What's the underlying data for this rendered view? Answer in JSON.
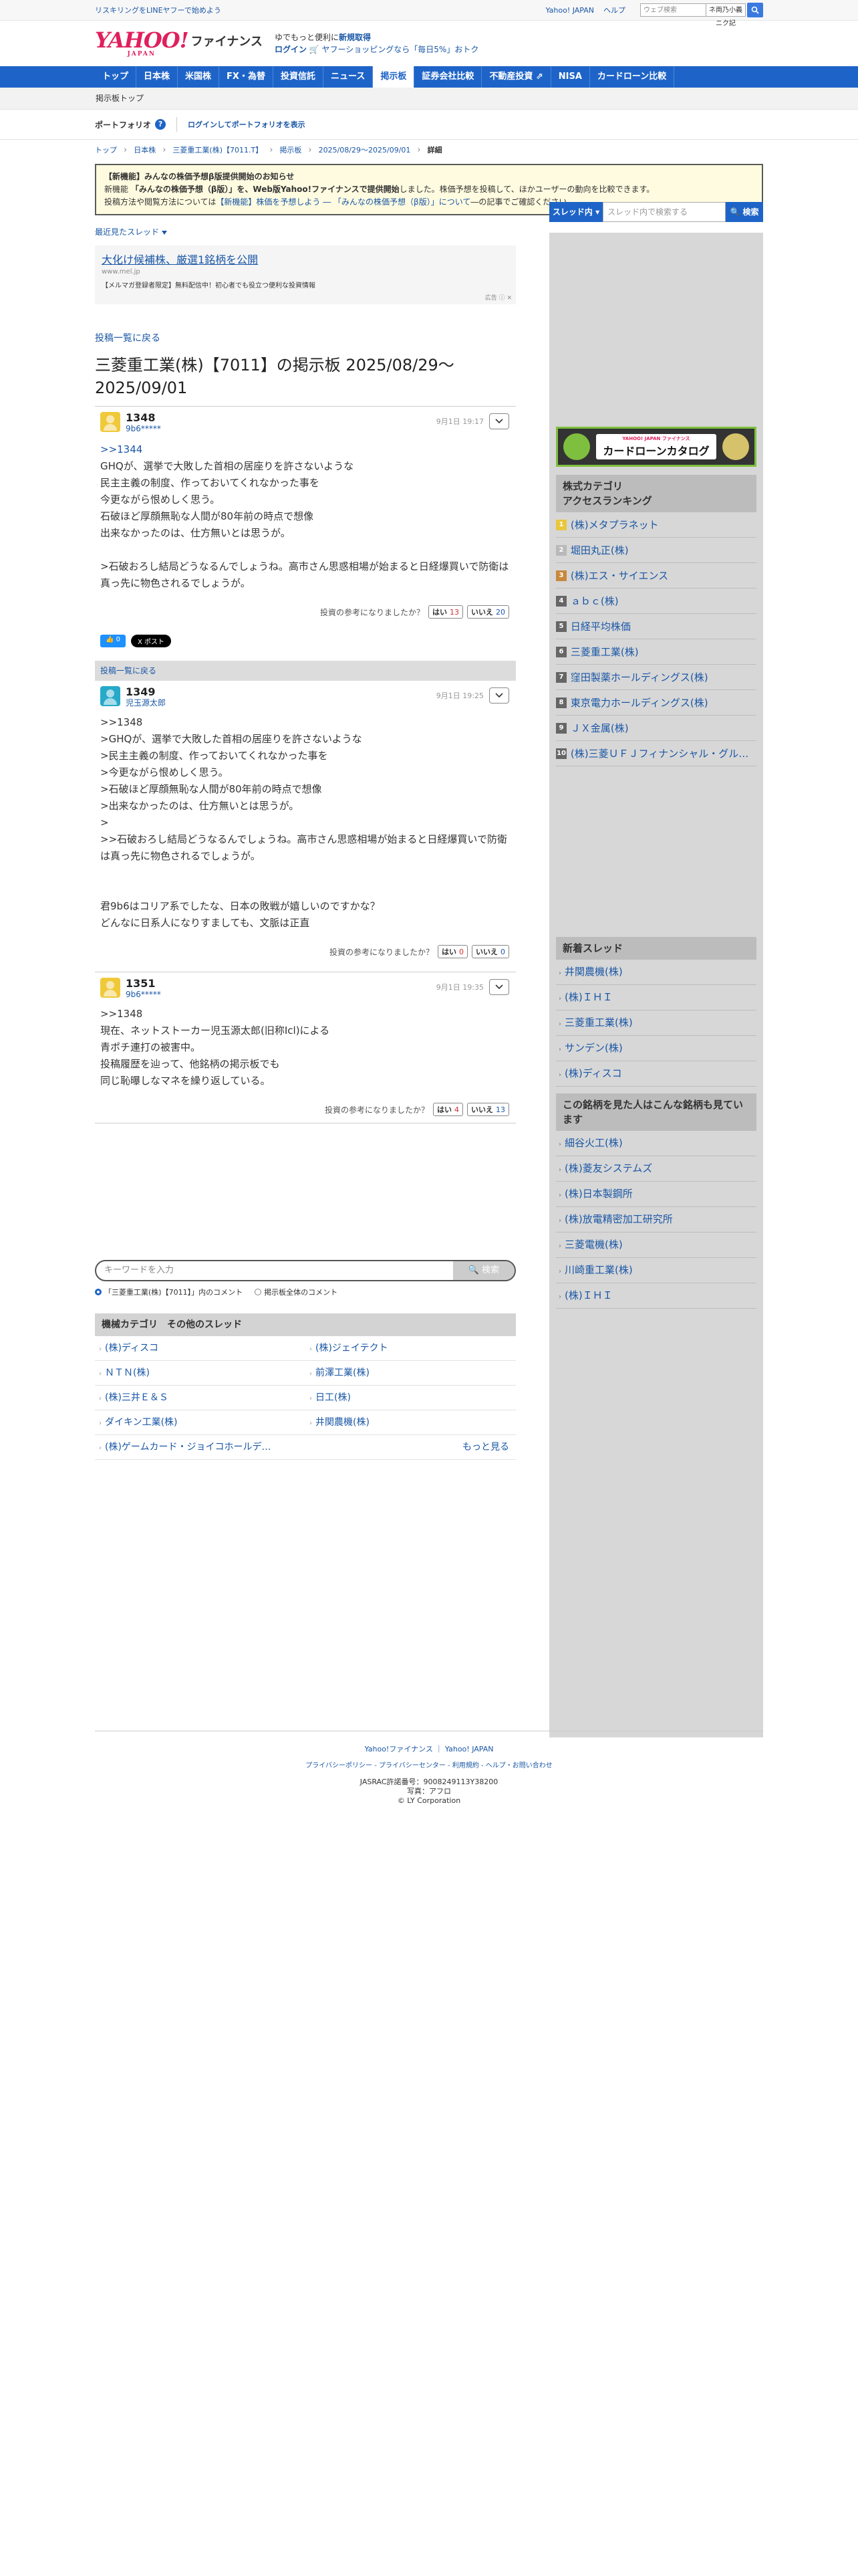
{
  "topbar": {
    "promo": "リスキリングをLINEヤフーで始めよう",
    "links": [
      "Yahoo! JAPAN",
      "ヘルプ"
    ],
    "search_placeholder": "ウェブ検索",
    "search_scope": "ネ両乃小義ニク記"
  },
  "header": {
    "logo_text": "YAHOO!",
    "logo_sub": "JAPAN",
    "logo_finance": "ファイナンス",
    "line1_pre": "ゆでもっと便利に",
    "line1_bold": "新規取得",
    "line2_login": "ログイン",
    "line2_rest": "🛒 ヤフーショッピングなら「毎日5%」おトク"
  },
  "nav": {
    "items": [
      "トップ",
      "日本株",
      "米国株",
      "FX・為替",
      "投資信託",
      "ニュース",
      "掲示板",
      "証券会社比較",
      "不動産投資 ⇗",
      "NISA",
      "カードローン比較"
    ],
    "active_index": 6
  },
  "subbar": {
    "label": "掲示板トップ"
  },
  "portfolio": {
    "title": "ポートフォリオ",
    "help_glyph": "?",
    "login_link": "ログインしてポートフォリオを表示"
  },
  "breadcrumb": {
    "items": [
      "トップ",
      "日本株",
      "三菱重工業(株)【7011.T】",
      "掲示板",
      "2025/08/29〜2025/09/01"
    ],
    "current": "詳細"
  },
  "notice": {
    "l1": "【新機能】みんなの株価予想β版提供開始のお知らせ",
    "l2_pre": "新機能 ",
    "l2_bold": "「みんなの株価予想（β版）」を、Web版Yahoo!ファイナンスで提供開始",
    "l2_post": "しました。株価予想を投稿して、ほかユーザーの動向を比較できます。",
    "l3_pre": "投稿方法や閲覧方法については",
    "l3_link": "【新機能】株価を予想しよう ― 「みんなの株価予想（β版）」について",
    "l3_post": "―の記事でご確認ください。"
  },
  "recent_label": "最近見たスレッド",
  "ad_top": {
    "headline": "大化け候補株、厳選1銘柄を公開",
    "domain": "www.mel.jp",
    "snippet": "【メルマガ登録者限定】無料配信中！初心者でも役立つ便利な投資情報",
    "mark": "広告 ⓘ ✕"
  },
  "back_link": "投稿一覧に戻る",
  "page_title": "三菱重工業(株)【7011】の掲示板 2025/08/29〜2025/09/01",
  "posts": [
    {
      "num": "1348",
      "user": "9b6*****",
      "date": "9月1日 19:17",
      "ref": ">>1344",
      "body": "GHQが、選挙で大敗した首相の居座りを許さないような\n民主主義の制度、作っておいてくれなかった事を\n今更ながら恨めしく思う。\n石破ほど厚顔無恥な人間が80年前の時点で想像\n出来なかったのは、仕方無いとは思うが。\n\n>石破おろし結局どうなるんでしょうね。高市さん思惑相場が始まると日経爆買いで防衛は真っ先に物色されるでしょうが。",
      "vote_q": "投資の参考になりましたか？",
      "yes_label": "はい",
      "yes": "13",
      "no_label": "いいえ",
      "no": "20",
      "share_fb": "👍 0",
      "share_x": "X ポスト"
    },
    {
      "num": "1349",
      "user": "児玉源太郎",
      "date": "9月1日 19:25",
      "body": ">>1348\n>GHQが、選挙で大敗した首相の居座りを許さないような\n>民主主義の制度、作っておいてくれなかった事を\n>今更ながら恨めしく思う。\n>石破ほど厚顔無恥な人間が80年前の時点で想像\n>出来なかったのは、仕方無いとは思うが。\n>\n>>石破おろし結局どうなるんでしょうね。高市さん思惑相場が始まると日経爆買いで防衛は真っ先に物色されるでしょうが。\n\n\n君9b6はコリア系でしたな、日本の敗戦が嬉しいのですかな？\nどんなに日系人になりすましても、文脈は正直",
      "vote_q": "投資の参考になりましたか？",
      "yes_label": "はい",
      "yes": "0",
      "no_label": "いいえ",
      "no": "0"
    },
    {
      "num": "1351",
      "user": "9b6*****",
      "date": "9月1日 19:35",
      "body": ">>1348\n現在、ネットストーカー児玉源太郎(旧称Icl)による\n青ポチ連打の被害中。\n投稿履歴を辿って、他銘柄の掲示板でも\n同じ恥曝しなマネを繰り返している。",
      "vote_q": "投資の参考になりましたか？",
      "yes_label": "はい",
      "yes": "4",
      "no_label": "いいえ",
      "no": "13"
    }
  ],
  "list_back_bar": "投稿一覧に戻る",
  "keyword_search": {
    "placeholder": "キーワードを入力",
    "button": "🔍 検索",
    "radio1": "「三菱重工業(株)【7011】」内のコメント",
    "radio2": "掲示板全体のコメント"
  },
  "other_threads": {
    "title": "機械カテゴリ　その他のスレッド",
    "items": [
      "(株)ディスコ",
      "(株)ジェイテクト",
      "ＮＴＮ(株)",
      "前澤工業(株)",
      "(株)三井Ｅ＆Ｓ",
      "日工(株)",
      "ダイキン工業(株)",
      "井関農機(株)",
      "(株)ゲームカード・ジョイコホールデ…"
    ],
    "more": "もっと見る"
  },
  "side": {
    "thread_scope": "スレッド内 ▾",
    "thread_placeholder": "スレッド内で検索する",
    "thread_button": "🔍 検索",
    "banner_brand": "YAHOO! JAPAN ファイナンス",
    "banner_title": "カードローンカタログ",
    "ranking_title": "株式カテゴリ\nアクセスランキング",
    "ranking": [
      "(株)メタプラネット",
      "堀田丸正(株)",
      "(株)エス・サイエンス",
      "ａｂｃ(株)",
      "日経平均株価",
      "三菱重工業(株)",
      "窪田製薬ホールディングス(株)",
      "東京電力ホールディングス(株)",
      "ＪＸ金属(株)",
      "(株)三菱ＵＦＪフィナンシャル・グループ"
    ],
    "new_title": "新着スレッド",
    "new_threads": [
      "井関農機(株)",
      "(株)ＩＨＩ",
      "三菱重工業(株)",
      "サンデン(株)",
      "(株)ディスコ"
    ],
    "also_title": "この銘柄を見た人はこんな銘柄も見ています",
    "also": [
      "細谷火工(株)",
      "(株)菱友システムズ",
      "(株)日本製鋼所",
      "(株)放電精密加工研究所",
      "三菱電機(株)",
      "川崎重工業(株)",
      "(株)ＩＨＩ"
    ]
  },
  "footer": {
    "row1": [
      "Yahoo!ファイナンス",
      "Yahoo! JAPAN"
    ],
    "row2": [
      "プライバシーポリシー",
      "プライバシーセンター",
      "利用規約",
      "ヘルプ・お問い合わせ"
    ],
    "jasrac": "JASRAC許諾番号：9008249113Y38200",
    "photo": "写真：アフロ",
    "copyright": "© LY Corporation"
  }
}
